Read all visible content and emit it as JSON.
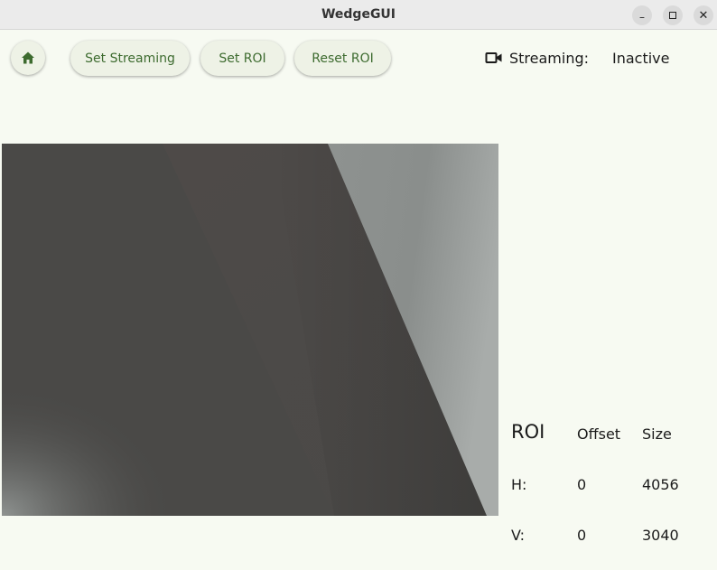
{
  "window": {
    "title": "WedgeGUI"
  },
  "toolbar": {
    "home_icon": "home-icon",
    "set_streaming_label": "Set Streaming",
    "set_roi_label": "Set ROI",
    "reset_roi_label": "Reset ROI"
  },
  "status": {
    "camera_icon": "video-camera-icon",
    "label": "Streaming:",
    "value": "Inactive"
  },
  "roi": {
    "title": "ROI",
    "headers": {
      "offset": "Offset",
      "size": "Size"
    },
    "rows": [
      {
        "label": "H:",
        "offset": "0",
        "size": "4056"
      },
      {
        "label": "V:",
        "offset": "0",
        "size": "3040"
      }
    ]
  },
  "colors": {
    "accent": "#3d6b2f",
    "background": "#f7faf2"
  }
}
